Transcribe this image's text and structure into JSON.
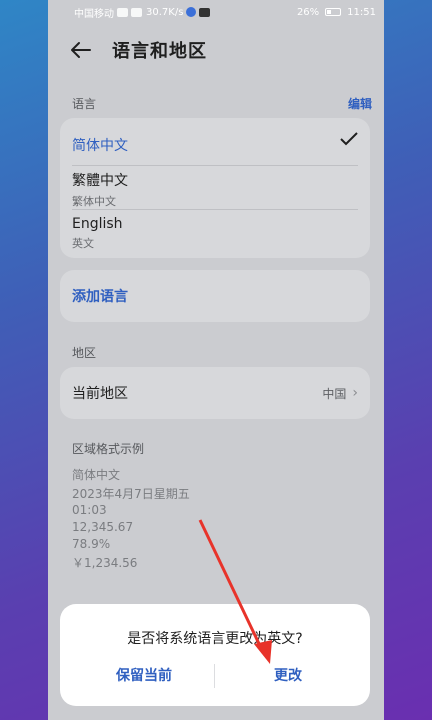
{
  "status_bar": {
    "carrier": "中国移动",
    "net_speed": "30.7K/s",
    "battery": "26%",
    "time": "11:51"
  },
  "header": {
    "title": "语言和地区",
    "back_icon": "arrow-left-icon"
  },
  "language_section": {
    "label": "语言",
    "edit_label": "编辑",
    "items": [
      {
        "name": "简体中文",
        "sub": "",
        "selected": true
      },
      {
        "name": "繁體中文",
        "sub": "繁体中文",
        "selected": false
      },
      {
        "name": "English",
        "sub": "英文",
        "selected": false
      }
    ],
    "add_label": "添加语言"
  },
  "region_section": {
    "label": "地区",
    "current_label": "当前地区",
    "current_value": "中国"
  },
  "format_sample": {
    "label": "区域格式示例",
    "lines": [
      "简体中文",
      "2023年4月7日星期五",
      "01:03",
      "12,345.67",
      "78.9%",
      "￥1,234.56"
    ]
  },
  "dialog": {
    "message": "是否将系统语言更改为英文?",
    "keep_label": "保留当前",
    "change_label": "更改"
  },
  "colors": {
    "accent": "#2f5fc0",
    "annotation_arrow": "#e8332a"
  }
}
